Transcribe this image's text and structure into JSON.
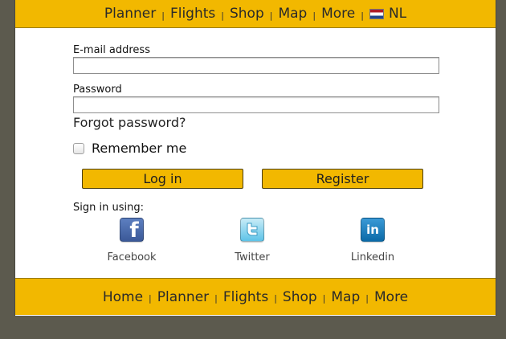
{
  "top_nav": {
    "items": [
      "Planner",
      "Flights",
      "Shop",
      "Map",
      "More"
    ],
    "language": {
      "code": "NL",
      "flag_icon": "netherlands-flag-icon"
    }
  },
  "login_form": {
    "email_label": "E-mail address",
    "email_value": "",
    "password_label": "Password",
    "password_value": "",
    "forgot_password": "Forgot password?",
    "remember_me_label": "Remember me",
    "remember_me_checked": false,
    "login_button": "Log in",
    "register_button": "Register"
  },
  "social_signin": {
    "label": "Sign in using:",
    "providers": [
      {
        "name": "Facebook",
        "icon": "facebook-icon"
      },
      {
        "name": "Twitter",
        "icon": "twitter-icon"
      },
      {
        "name": "Linkedin",
        "icon": "linkedin-icon"
      }
    ]
  },
  "bottom_nav": {
    "items": [
      "Home",
      "Planner",
      "Flights",
      "Shop",
      "Map",
      "More"
    ]
  },
  "colors": {
    "accent": "#f2b800",
    "background": "#5c5a4e",
    "facebook": "#3b5998",
    "twitter": "#5ec3e8",
    "linkedin": "#0b6aa8"
  }
}
